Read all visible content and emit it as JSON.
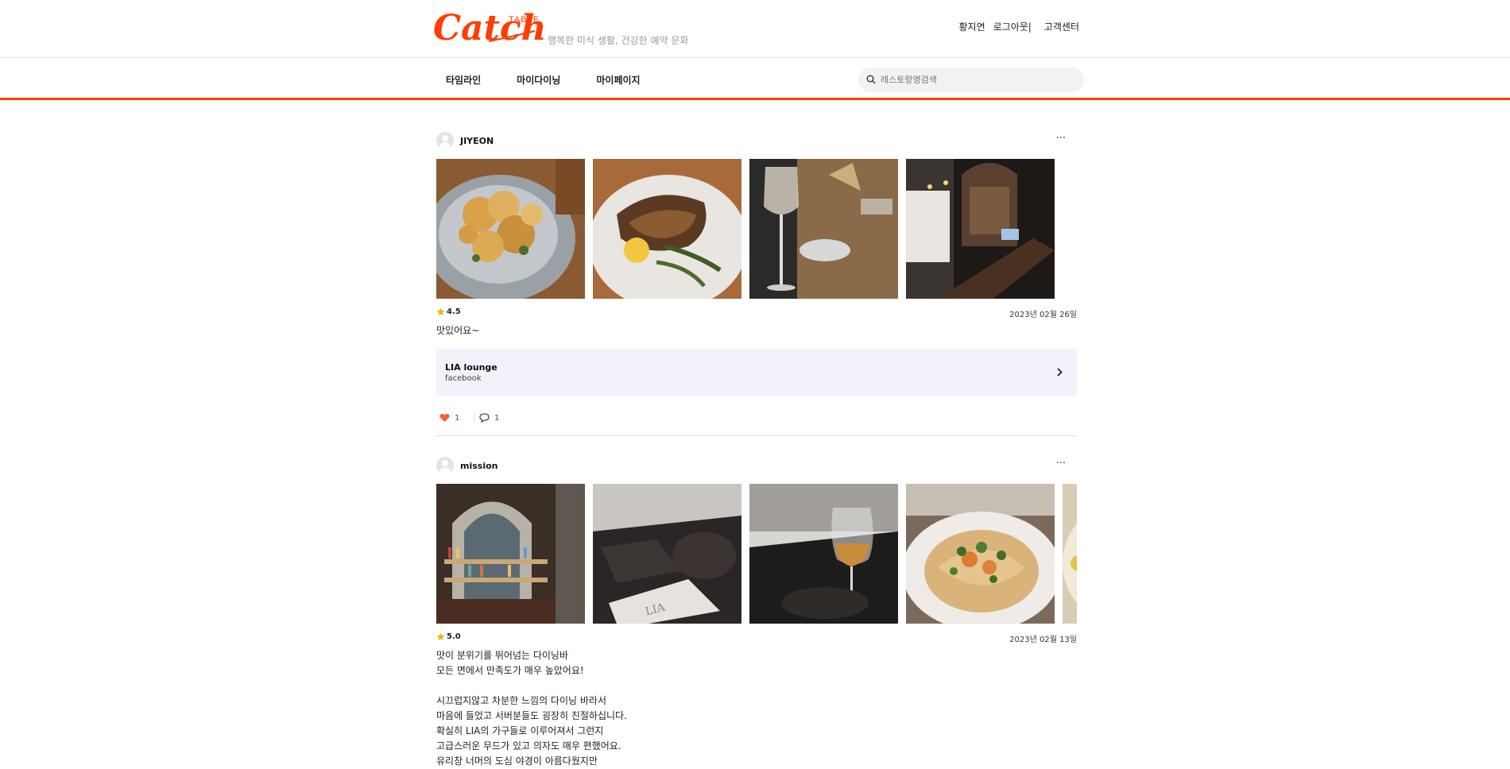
{
  "brand": {
    "logo_main": "Catch",
    "logo_sub": "TABLE",
    "tagline": "행복한 미식 생활, 건강한 예약 문화",
    "accent": "#ff3d00"
  },
  "top_links": {
    "user": "황지연",
    "logout": "로그아웃|",
    "support": "고객센터"
  },
  "nav": {
    "items": [
      "타임라인",
      "마이다이닝",
      "마이페이지"
    ],
    "search_placeholder": "레스토랑명검색"
  },
  "posts": [
    {
      "user": "JIYEON",
      "more": "···",
      "photos": [
        "fried-food-platter",
        "grilled-fish-plate",
        "wine-glass-table",
        "restaurant-interior"
      ],
      "rating": "4.5",
      "date": "2023년 02월 26일",
      "text": "맛있어요~",
      "restaurant": {
        "name": "LIA lounge",
        "sub": "facebook"
      },
      "likes": "1",
      "comments": "1"
    },
    {
      "user": "mission",
      "more": "···",
      "photos": [
        "bar-shelves",
        "napkin-table",
        "wine-glass",
        "pasta-dish",
        "pasta-partial"
      ],
      "rating": "5.0",
      "date": "2023년 02월 13일",
      "text": "맛이 분위기를 뛰어넘는 다이닝바\n모든 면에서 만족도가 매우 높았어요!\n\n시끄럽지않고 차분한 느낌의 다이닝 바라서\n마음에 들었고 서버분들도 굉장히 친절하십니다.\n확실히 LIA의 가구들로 이루어져서 그런지\n고급스러운 무드가 있고 의자도 매우 편했어요.\n유리창 너머의 도심 야경이 아름다웠지만"
    }
  ]
}
